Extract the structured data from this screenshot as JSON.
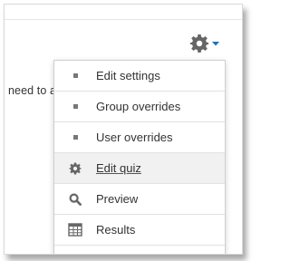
{
  "page": {
    "body_text": "need to a"
  },
  "toolbar": {
    "settings_icon": "gear-icon",
    "dropdown_icon": "caret-down-icon",
    "icon_color": "#666666",
    "caret_color": "#1f6fb6"
  },
  "menu": {
    "items": [
      {
        "label": "Edit settings",
        "icon": "bullet",
        "active": false
      },
      {
        "label": "Group overrides",
        "icon": "bullet",
        "active": false
      },
      {
        "label": "User overrides",
        "icon": "bullet",
        "active": false
      },
      {
        "label": "Edit quiz",
        "icon": "gear-icon",
        "active": true
      },
      {
        "label": "Preview",
        "icon": "search-icon",
        "active": false
      },
      {
        "label": "Results",
        "icon": "table-icon",
        "active": false
      }
    ]
  }
}
